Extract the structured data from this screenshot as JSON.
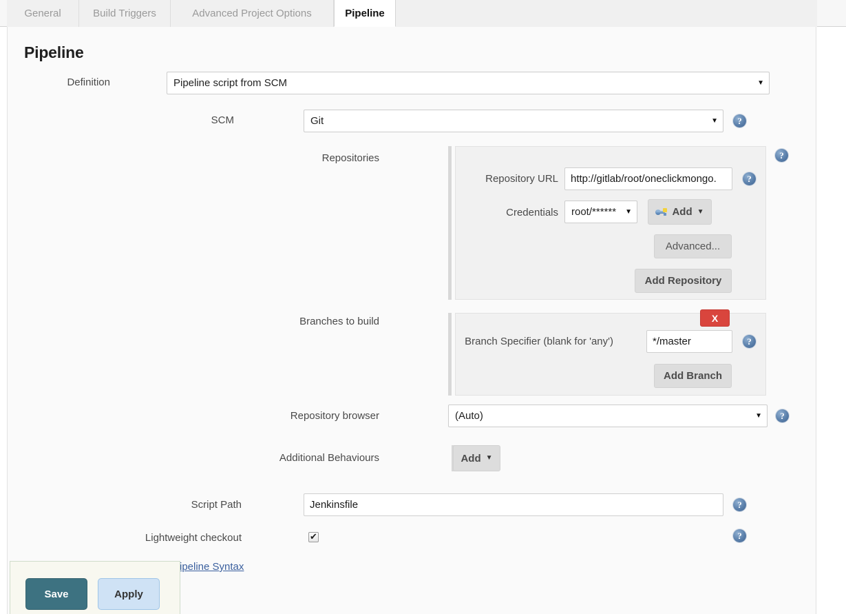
{
  "tabs": [
    {
      "label": "General",
      "active": false
    },
    {
      "label": "Build Triggers",
      "active": false
    },
    {
      "label": "Advanced Project Options",
      "active": false
    },
    {
      "label": "Pipeline",
      "active": true
    }
  ],
  "page": {
    "title": "Pipeline"
  },
  "definition": {
    "label": "Definition",
    "value": "Pipeline script from SCM"
  },
  "scm": {
    "label": "SCM",
    "value": "Git"
  },
  "repositories": {
    "label": "Repositories",
    "url_label": "Repository URL",
    "url_value": "http://gitlab/root/oneclickmongo.",
    "credentials_label": "Credentials",
    "credentials_value": "root/******",
    "add_credentials_label": "Add",
    "advanced_label": "Advanced...",
    "add_repository_label": "Add Repository"
  },
  "branches": {
    "label": "Branches to build",
    "specifier_label": "Branch Specifier (blank for 'any')",
    "specifier_value": "*/master",
    "add_branch_label": "Add Branch",
    "delete_label": "X"
  },
  "repository_browser": {
    "label": "Repository browser",
    "value": "(Auto)"
  },
  "additional_behaviours": {
    "label": "Additional Behaviours",
    "add_label": "Add"
  },
  "script_path": {
    "label": "Script Path",
    "value": "Jenkinsfile"
  },
  "lightweight_checkout": {
    "label": "Lightweight checkout",
    "checked": true,
    "mark": "✔"
  },
  "pipeline_syntax_link": "Pipeline Syntax",
  "footer": {
    "save_label": "Save",
    "apply_label": "Apply"
  },
  "icons": {
    "help": "?",
    "caret_down": "▼"
  },
  "colors": {
    "save_button": "#3d7281",
    "apply_button": "#cfe2f5",
    "delete_button": "#d9453d",
    "help_icon": "#4f74a3",
    "link": "#3a5f9e"
  }
}
